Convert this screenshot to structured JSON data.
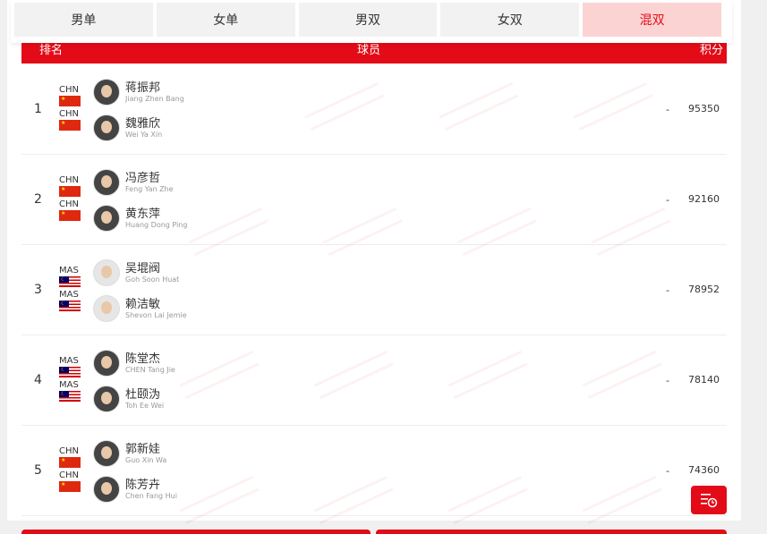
{
  "tabs": [
    {
      "label": "男单",
      "active": false
    },
    {
      "label": "女单",
      "active": false
    },
    {
      "label": "男双",
      "active": false
    },
    {
      "label": "女双",
      "active": false
    },
    {
      "label": "混双",
      "active": true
    }
  ],
  "header": {
    "rank": "排名",
    "player": "球员",
    "points": "积分"
  },
  "rows": [
    {
      "rank": "1",
      "dash": "-",
      "points": "95350",
      "players": [
        {
          "country": "CHN",
          "flag": "chn",
          "name": "蒋振邦",
          "ename": "Jiang Zhen Bang"
        },
        {
          "country": "CHN",
          "flag": "chn",
          "name": "魏雅欣",
          "ename": "Wei Ya Xin"
        }
      ]
    },
    {
      "rank": "2",
      "dash": "-",
      "points": "92160",
      "players": [
        {
          "country": "CHN",
          "flag": "chn",
          "name": "冯彦哲",
          "ename": "Feng Yan Zhe"
        },
        {
          "country": "CHN",
          "flag": "chn",
          "name": "黄东萍",
          "ename": "Huang Dong Ping"
        }
      ]
    },
    {
      "rank": "3",
      "dash": "-",
      "points": "78952",
      "players": [
        {
          "country": "MAS",
          "flag": "mas",
          "name": "吴堒阀",
          "ename": "Goh Soon Huat"
        },
        {
          "country": "MAS",
          "flag": "mas",
          "name": "赖洁敏",
          "ename": "Shevon Lai Jemie"
        }
      ]
    },
    {
      "rank": "4",
      "dash": "-",
      "points": "78140",
      "players": [
        {
          "country": "MAS",
          "flag": "mas",
          "name": "陈堂杰",
          "ename": "CHEN Tang Jie"
        },
        {
          "country": "MAS",
          "flag": "mas",
          "name": "杜颐沩",
          "ename": "Toh Ee Wei"
        }
      ]
    },
    {
      "rank": "5",
      "dash": "-",
      "points": "74360",
      "players": [
        {
          "country": "CHN",
          "flag": "chn",
          "name": "郭新娃",
          "ename": "Guo Xin Wa"
        },
        {
          "country": "CHN",
          "flag": "chn",
          "name": "陈芳卉",
          "ename": "Chen Fang Hui"
        }
      ]
    }
  ],
  "colors": {
    "accent": "#e30b17",
    "active_tab_bg": "#fcd3d3"
  },
  "float_button": {
    "icon": "history-list-icon"
  }
}
